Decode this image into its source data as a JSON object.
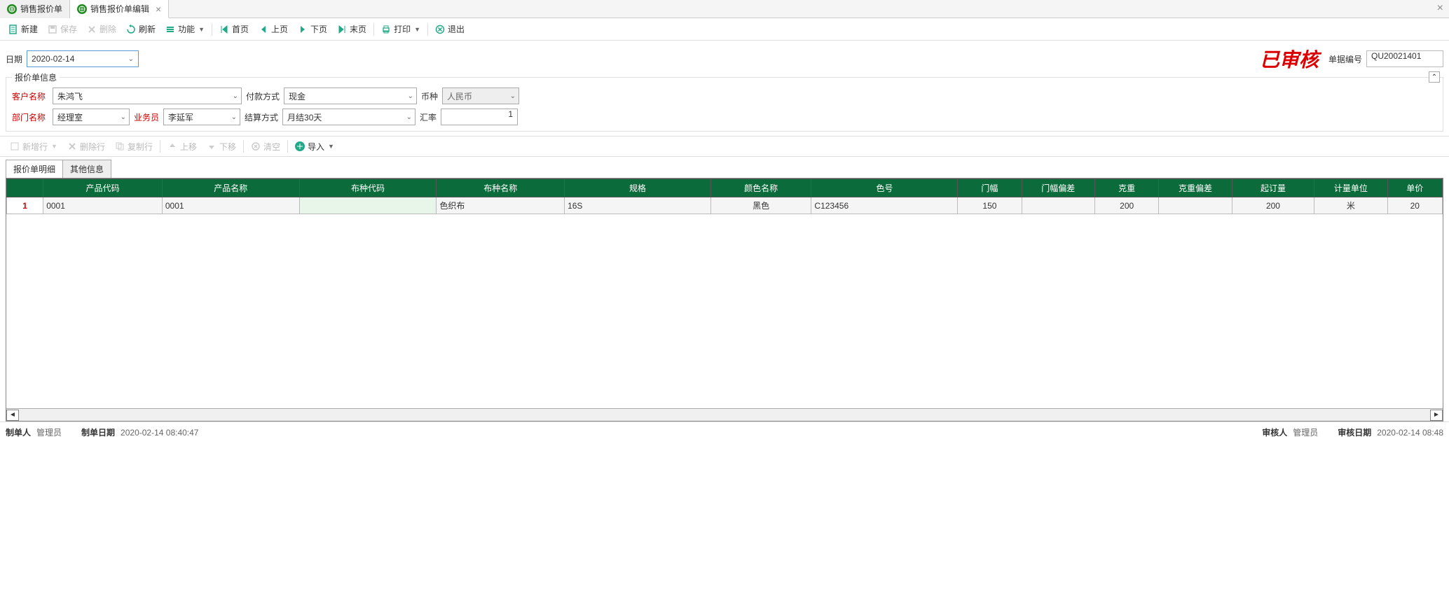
{
  "tabs": [
    {
      "label": "销售报价单"
    },
    {
      "label": "销售报价单编辑"
    }
  ],
  "toolbar": {
    "new": "新建",
    "save": "保存",
    "delete": "删除",
    "refresh": "刷新",
    "function": "功能",
    "first": "首页",
    "prev": "上页",
    "next": "下页",
    "last": "末页",
    "print": "打印",
    "exit": "退出"
  },
  "date_label": "日期",
  "date_value": "2020-02-14",
  "audit_stamp": "已审核",
  "doc_no_label": "单据编号",
  "doc_no_value": "QU20021401",
  "form": {
    "title": "报价单信息",
    "customer_label": "客户名称",
    "customer_value": "朱鸿飞",
    "payment_label": "付款方式",
    "payment_value": "现金",
    "currency_label": "币种",
    "currency_value": "人民币",
    "dept_label": "部门名称",
    "dept_value": "经理室",
    "salesman_label": "业务员",
    "salesman_value": "李延军",
    "settle_label": "结算方式",
    "settle_value": "月结30天",
    "rate_label": "汇率",
    "rate_value": "1"
  },
  "row_toolbar": {
    "add_row": "新增行",
    "del_row": "删除行",
    "copy_row": "复制行",
    "move_up": "上移",
    "move_down": "下移",
    "clear": "清空",
    "import": "导入"
  },
  "detail_tabs": {
    "detail": "报价单明细",
    "other": "其他信息"
  },
  "grid": {
    "headers": [
      "",
      "产品代码",
      "产品名称",
      "布种代码",
      "布种名称",
      "规格",
      "颜色名称",
      "色号",
      "门幅",
      "门幅偏差",
      "克重",
      "克重偏差",
      "起订量",
      "计量单位",
      "单价"
    ],
    "row_num": "1",
    "row": {
      "product_code": "0001",
      "product_name": "0001",
      "fabric_code": "",
      "fabric_name": "色织布",
      "spec": "16S",
      "color_name": "黑色",
      "color_no": "C123456",
      "width": "150",
      "width_dev": "",
      "weight": "200",
      "weight_dev": "",
      "moq": "200",
      "uom": "米",
      "price": "20"
    }
  },
  "footer": {
    "creator_label": "制单人",
    "creator_value": "管理员",
    "create_date_label": "制单日期",
    "create_date_value": "2020-02-14 08:40:47",
    "auditor_label": "审核人",
    "auditor_value": "管理员",
    "audit_date_label": "审核日期",
    "audit_date_value": "2020-02-14 08:48"
  }
}
